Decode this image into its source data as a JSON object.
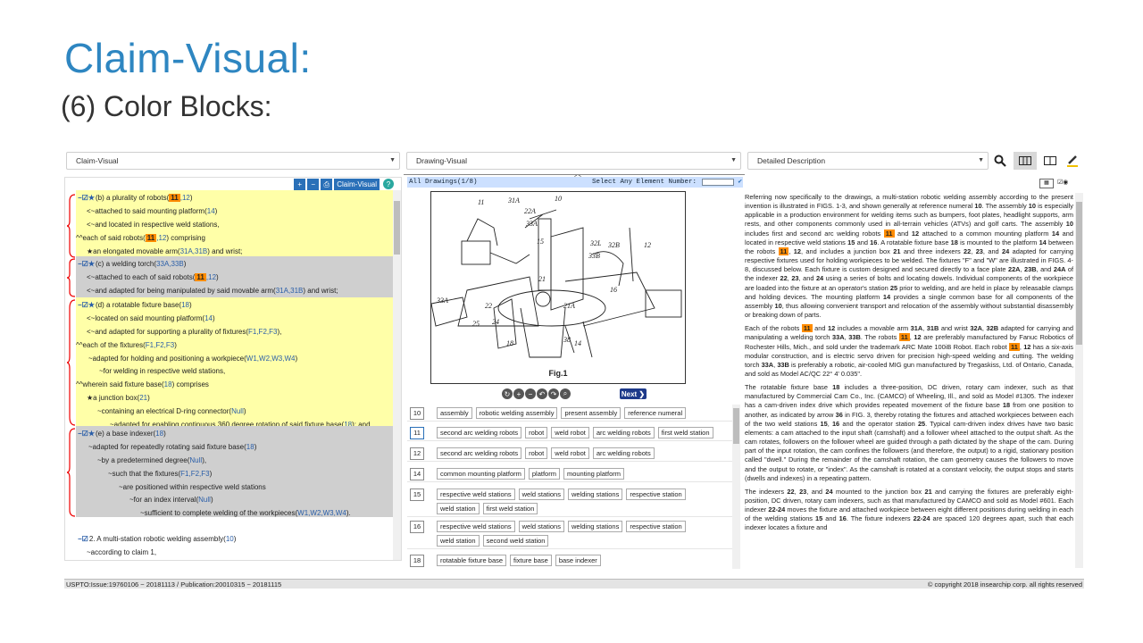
{
  "slide": {
    "title": "Claim-Visual:",
    "subtitle": "(6) Color Blocks:"
  },
  "toolbar": {
    "left_select": "Claim-Visual",
    "middle_select": "Drawing-Visual",
    "right_select": "Detailed Description",
    "icons": [
      "search-icon",
      "three-column-icon",
      "two-column-icon",
      "highlighter-icon"
    ]
  },
  "claims_toolbar": {
    "claim_visual_label": "Claim-Visual",
    "help": "?"
  },
  "claims": {
    "b1": [
      {
        "pre": "",
        "text": "(b) a plurality of robots(",
        "hl": "11",
        "refs": ",12",
        "end": ")"
      },
      {
        "pre": "<~",
        "text": "attached to said mounting platform(",
        "refs": "14",
        "end": ")"
      },
      {
        "pre": "<~",
        "text": "and located in respective weld stations,"
      },
      {
        "pre": "^^",
        "text": "each of said robots(",
        "hl": "11",
        "refs": ",12",
        "end": ") comprising"
      },
      {
        "pre": "★",
        "text": "an elongated movable arm(",
        "refs": "31A,31B",
        "end": ") and wrist;"
      }
    ],
    "b2": [
      {
        "pre": "",
        "text": "(c) a welding torch(",
        "refs": "33A,33B",
        "end": ")"
      },
      {
        "pre": "<~",
        "text": "attached to each of said robots(",
        "hl": "11",
        "refs": ",12",
        "end": ")"
      },
      {
        "pre": "<~",
        "text": "and adapted for being manipulated by said movable arm(",
        "refs": "31A,31B",
        "end": ") and wrist;"
      }
    ],
    "b3": [
      {
        "pre": "",
        "text": "(d) a rotatable fixture base(",
        "refs": "18",
        "end": ")"
      },
      {
        "pre": "<~",
        "text": "located on said mounting platform(",
        "refs": "14",
        "end": ")"
      },
      {
        "pre": "<~",
        "text": "and adapted for supporting a plurality of fixtures(",
        "refs": "F1,F2,F3",
        "end": "),"
      },
      {
        "pre": "^^",
        "text": "each of the fixtures(",
        "refs": "F1,F2,F3",
        "end": ")"
      },
      {
        "pre": "~",
        "text": "adapted for holding and positioning a workpiece(",
        "refs": "W1,W2,W3,W4",
        "end": ")"
      },
      {
        "pre": "~",
        "text": "for welding in respective weld stations,"
      },
      {
        "pre": "^^",
        "text": "wherein said fixture base(",
        "refs": "18",
        "end": ") comprises"
      },
      {
        "pre": "★",
        "text": "a junction box(",
        "refs": "21",
        "end": ")"
      },
      {
        "pre": "~",
        "text": "containing an electrical D-ring connector(",
        "refs": "Null",
        "end": ")"
      },
      {
        "pre": "~",
        "text": "adapted for enabling continuous 360 degree rotation of said fixture base(",
        "refs": "18",
        "end": "); and"
      }
    ],
    "b4": [
      {
        "pre": "",
        "text": "(e) a base indexer(",
        "refs": "18",
        "end": ")"
      },
      {
        "pre": "~",
        "text": "adapted for repeatedly rotating said fixture base(",
        "refs": "18",
        "end": ")"
      },
      {
        "pre": "~",
        "text": "by a predetermined degree(",
        "refs": "Null",
        "end": "),"
      },
      {
        "pre": "~",
        "text": "such that the fixtures(",
        "refs": "F1,F2,F3",
        "end": ")"
      },
      {
        "pre": "~",
        "text": "are positioned within respective weld stations"
      },
      {
        "pre": "~",
        "text": "for an index interval(",
        "refs": "Null",
        "end": ")"
      },
      {
        "pre": "~",
        "text": "sufficient to complete welding of the workpieces(",
        "refs": "W1,W2,W3,W4",
        "end": ")."
      }
    ],
    "claim2": {
      "text": "2. A multi-station robotic welding assembly(",
      "refs": "10",
      "end": ")",
      "sub": "~according to claim 1,"
    }
  },
  "drawings": {
    "header": "All Drawings(1/8)",
    "select_label": "Select Any Element Number:",
    "fig_label": "Fig.1",
    "next_label": "Next",
    "callouts": [
      "11",
      "31A",
      "10",
      "22A",
      "33A",
      "15",
      "33B",
      "32B",
      "12",
      "21",
      "16",
      "33A",
      "22",
      "21A",
      "25",
      "24",
      "18",
      "38",
      "14",
      "32L"
    ]
  },
  "elements": [
    {
      "num": "10",
      "chips": [
        "assembly",
        "robotic welding assembly",
        "present assembly",
        "reference numeral"
      ]
    },
    {
      "num": "11",
      "chips": [
        "second arc welding robots",
        "robot",
        "weld robot",
        "arc welding robots",
        "first weld station"
      ]
    },
    {
      "num": "12",
      "chips": [
        "second arc welding robots",
        "robot",
        "weld robot",
        "arc welding robots"
      ]
    },
    {
      "num": "14",
      "chips": [
        "common mounting platform",
        "platform",
        "mounting platform"
      ]
    },
    {
      "num": "15",
      "chips": [
        "respective weld stations",
        "weld stations",
        "welding stations",
        "respective station",
        "weld station",
        "first weld station"
      ]
    },
    {
      "num": "16",
      "chips": [
        "respective weld stations",
        "weld stations",
        "welding stations",
        "respective station",
        "weld station",
        "second weld station"
      ]
    },
    {
      "num": "18",
      "chips": [
        "rotatable fixture base",
        "fixture base",
        "base indexer"
      ]
    }
  ],
  "status": {
    "left": "USPTO:Issue:19760106 ~ 20181113 / Publication:20010315 ~ 20181115",
    "right": "© copyright 2018 insearchip corp. all rights reserved"
  }
}
